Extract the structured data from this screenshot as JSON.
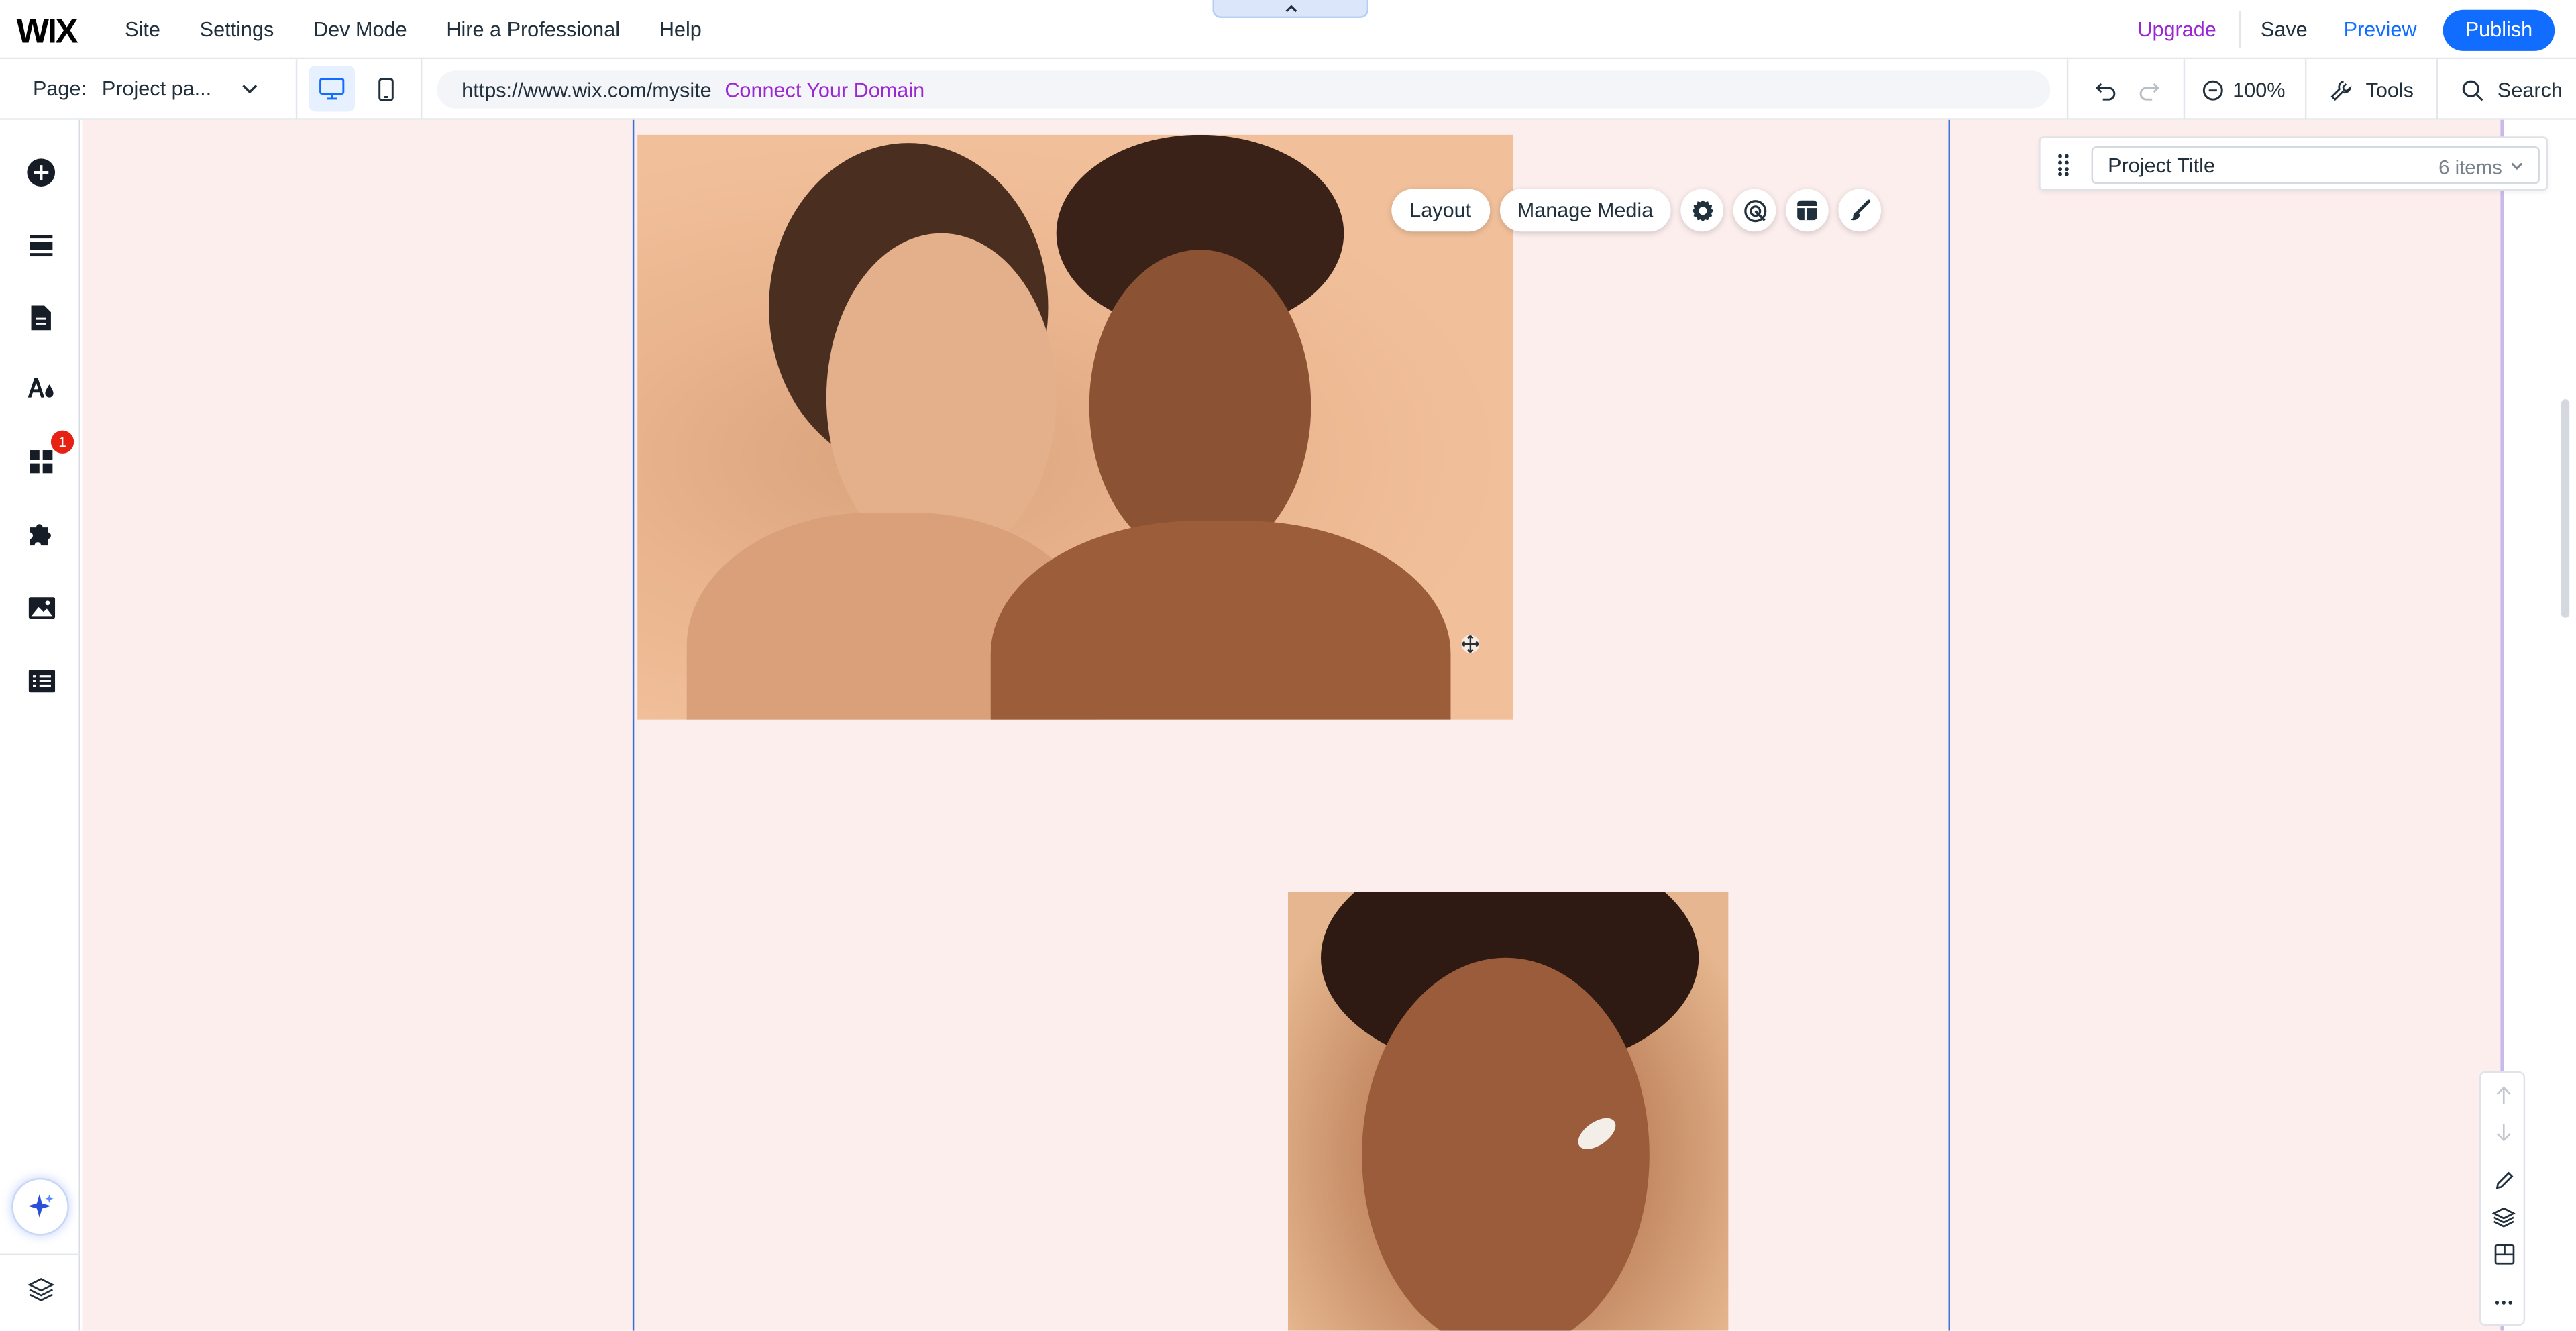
{
  "brand": {
    "logo": "WIX"
  },
  "top_menu": [
    "Site",
    "Settings",
    "Dev Mode",
    "Hire a Professional",
    "Help"
  ],
  "top_right": {
    "upgrade": "Upgrade",
    "save": "Save",
    "preview": "Preview",
    "publish": "Publish"
  },
  "page_bar": {
    "page_label": "Page:",
    "page_name": "Project pa...",
    "url": "https://www.wix.com/mysite",
    "connect_domain": "Connect Your Domain",
    "zoom": "100%",
    "tools": "Tools",
    "search": "Search"
  },
  "sidebar": {
    "items": [
      "plus-icon",
      "sections-icon",
      "pages-icon",
      "design-icon",
      "apps-icon",
      "puzzle-icon",
      "media-icon",
      "cms-icon"
    ],
    "apps_badge": "1"
  },
  "floating_toolbar": {
    "layout": "Layout",
    "manage_media": "Manage Media"
  },
  "project_panel": {
    "title": "Project Title",
    "count": "6 items"
  },
  "colors": {
    "accent": "#116dff",
    "upgrade": "#9a27d5",
    "canvas": "#fdeeee",
    "selection": "#3b6fd8"
  }
}
